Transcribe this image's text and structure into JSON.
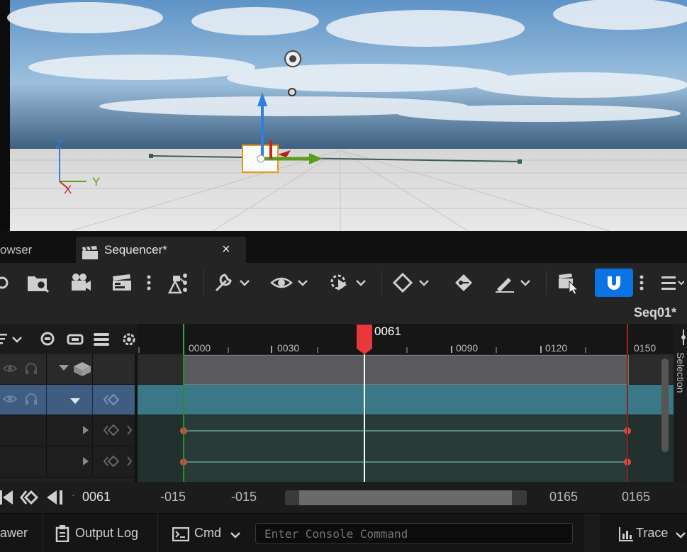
{
  "viewport": {
    "gizmo_axes": {
      "x": "X",
      "y": "Y",
      "z": "Z"
    }
  },
  "tabs": {
    "browser_partial": "owser",
    "sequencer": "Sequencer*",
    "close": "×"
  },
  "sequence": {
    "name": "Seq01*"
  },
  "ruler": {
    "ticks": [
      "0000",
      "0030",
      "0090",
      "0120",
      "0150"
    ],
    "playhead_frame": "0061"
  },
  "transport": {
    "current_frame": "0061",
    "view_start_1": "-015",
    "view_start_2": "-015",
    "view_end_1": "0165",
    "view_end_2": "0165"
  },
  "statusbar": {
    "drawer_partial": "awer",
    "output_log": "Output Log",
    "cmd": "Cmd",
    "console_placeholder": "Enter Console Command",
    "trace": "Trace"
  },
  "right_panel": {
    "label": "Selection"
  },
  "colors": {
    "accent_blue": "#0a74e6",
    "playhead_red": "#e8383b",
    "track_teal": "#3a7887",
    "track_gray": "#5a5a5e",
    "sky": "#7fa9cf"
  }
}
